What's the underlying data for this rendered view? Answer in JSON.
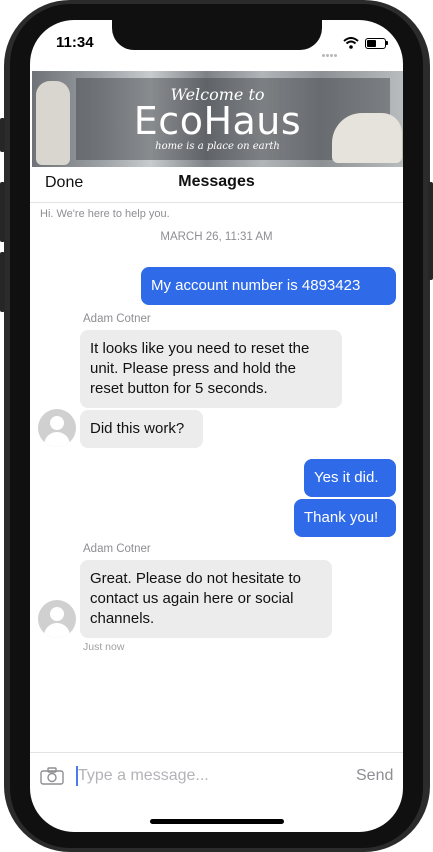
{
  "status_bar": {
    "time": "11:34"
  },
  "banner": {
    "welcome": "Welcome to",
    "brand": "EcoHaus",
    "tagline": "home is a place on earth"
  },
  "nav": {
    "done_label": "Done",
    "title": "Messages"
  },
  "greeting": "Hi. We're here to help you.",
  "date_stamp": "MARCH 26, 11:31 AM",
  "messages": [
    {
      "from": "user",
      "text": "My account number is 4893423"
    },
    {
      "from": "agent",
      "sender": "Adam Cotner",
      "text": "It looks like you need to reset the unit. Please press and hold the reset button for 5 seconds."
    },
    {
      "from": "agent",
      "text": "Did this work?"
    },
    {
      "from": "user",
      "text": "Yes it did."
    },
    {
      "from": "user",
      "text": "Thank you!"
    },
    {
      "from": "agent",
      "sender": "Adam Cotner",
      "text": "Great. Please do not hesitate to contact us again here or social channels."
    }
  ],
  "last_timestamp": "Just now",
  "composer": {
    "placeholder": "Type a message...",
    "send_label": "Send"
  },
  "colors": {
    "outgoing_bubble": "#2f6ae8",
    "incoming_bubble": "#ececec",
    "accent": "#2f6ae8"
  }
}
